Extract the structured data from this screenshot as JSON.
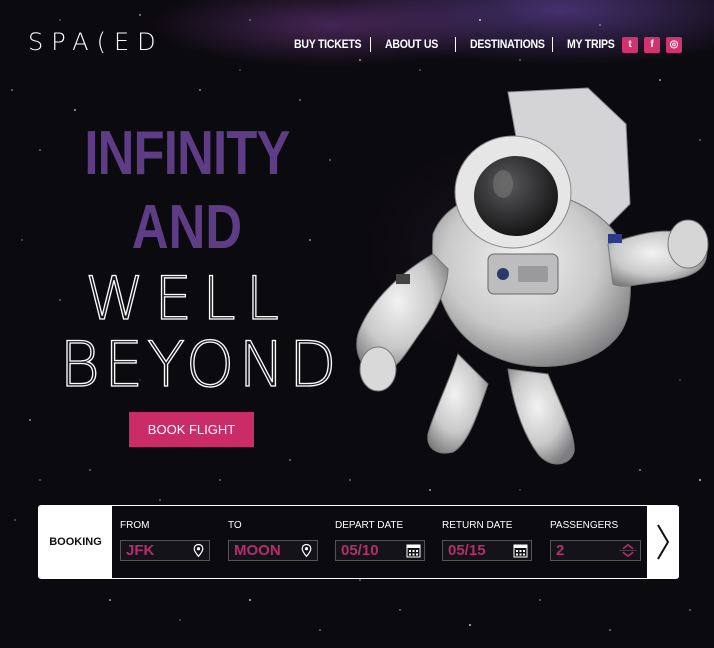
{
  "brand": {
    "logo_text": "SPA(ED"
  },
  "nav": {
    "items": [
      {
        "label": "BUY TICKETS"
      },
      {
        "label": "ABOUT US"
      },
      {
        "label": "DESTINATIONS"
      },
      {
        "label": "MY TRIPS"
      }
    ]
  },
  "social": [
    {
      "icon": "twitter-icon",
      "glyph": "t"
    },
    {
      "icon": "facebook-icon",
      "glyph": "f"
    },
    {
      "icon": "instagram-icon",
      "glyph": "◎"
    }
  ],
  "hero": {
    "line1": "INFINITY",
    "line2": "AND",
    "line3": "WELL",
    "line4": "BEYOND",
    "cta_label": "BOOK FLIGHT"
  },
  "booking": {
    "title": "BOOKING",
    "fields": [
      {
        "label": "FROM",
        "value": "JFK",
        "icon": "location-pin-icon"
      },
      {
        "label": "TO",
        "value": "MOON",
        "icon": "location-pin-icon"
      },
      {
        "label": "DEPART DATE",
        "value": "05/10",
        "icon": "calendar-icon"
      },
      {
        "label": "RETURN DATE",
        "value": "05/15",
        "icon": "calendar-icon"
      },
      {
        "label": "PASSENGERS",
        "value": "2",
        "icon": "stepper-icon"
      }
    ],
    "next_icon": "chevron-right-icon"
  },
  "colors": {
    "accent": "#c92c66",
    "hero_purple": "#5f3d86",
    "field_value": "#b1306a",
    "background": "#0b0a0e"
  }
}
